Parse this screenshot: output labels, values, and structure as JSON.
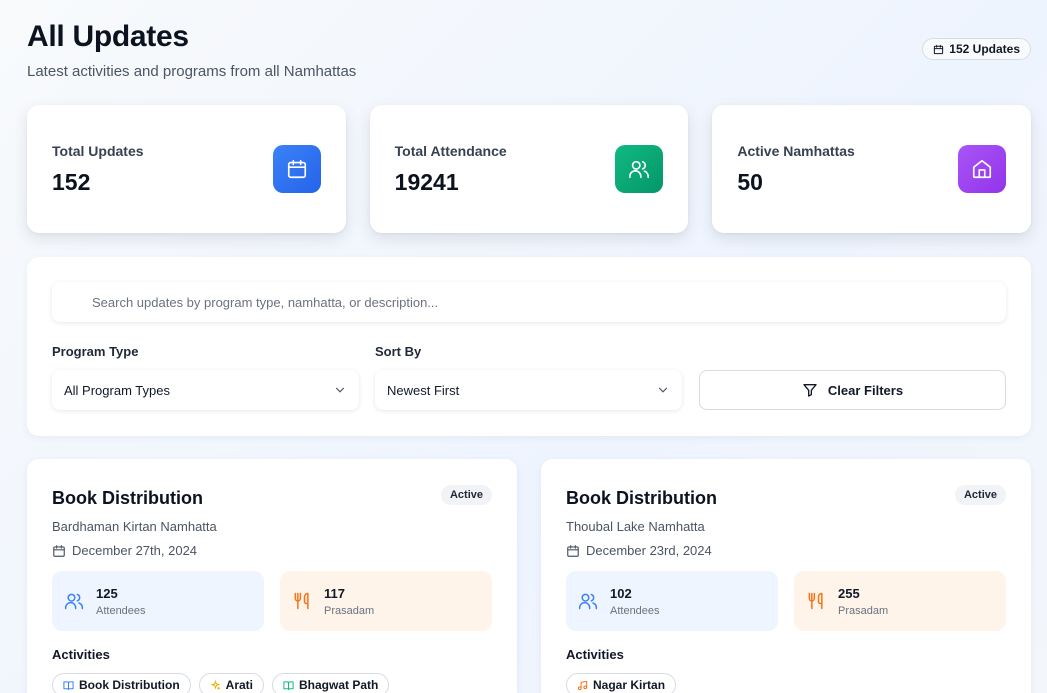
{
  "header": {
    "title": "All Updates",
    "subtitle": "Latest activities and programs from all Namhattas",
    "count_badge": "152 Updates"
  },
  "stats": [
    {
      "label": "Total Updates",
      "value": "152",
      "icon": "calendar-icon",
      "color": "#3b82f6"
    },
    {
      "label": "Total Attendance",
      "value": "19241",
      "icon": "users-icon",
      "color": "#10b981"
    },
    {
      "label": "Active Namhattas",
      "value": "50",
      "icon": "home-icon",
      "color": "#a855f7"
    }
  ],
  "filters": {
    "search_placeholder": "Search updates by program type, namhatta, or description...",
    "search_value": "",
    "program_type_label": "Program Type",
    "program_type_value": "All Program Types",
    "sort_by_label": "Sort By",
    "sort_by_value": "Newest First",
    "clear_label": "Clear Filters"
  },
  "updates": [
    {
      "title": "Book Distribution",
      "status": "Active",
      "namhatta": "Bardhaman Kirtan Namhatta",
      "date": "December 27th, 2024",
      "attendees": "125",
      "attendees_label": "Attendees",
      "prasadam": "117",
      "prasadam_label": "Prasadam",
      "activities_title": "Activities",
      "activities": [
        {
          "label": "Book Distribution",
          "icon": "book-icon",
          "color": "#3b82f6"
        },
        {
          "label": "Arati",
          "icon": "sparkle-icon",
          "color": "#eab308"
        },
        {
          "label": "Bhagwat Path",
          "icon": "book-icon",
          "color": "#10b981"
        }
      ]
    },
    {
      "title": "Book Distribution",
      "status": "Active",
      "namhatta": "Thoubal Lake Namhatta",
      "date": "December 23rd, 2024",
      "attendees": "102",
      "attendees_label": "Attendees",
      "prasadam": "255",
      "prasadam_label": "Prasadam",
      "activities_title": "Activities",
      "activities": [
        {
          "label": "Nagar Kirtan",
          "icon": "music-icon",
          "color": "#f97316"
        }
      ]
    }
  ]
}
